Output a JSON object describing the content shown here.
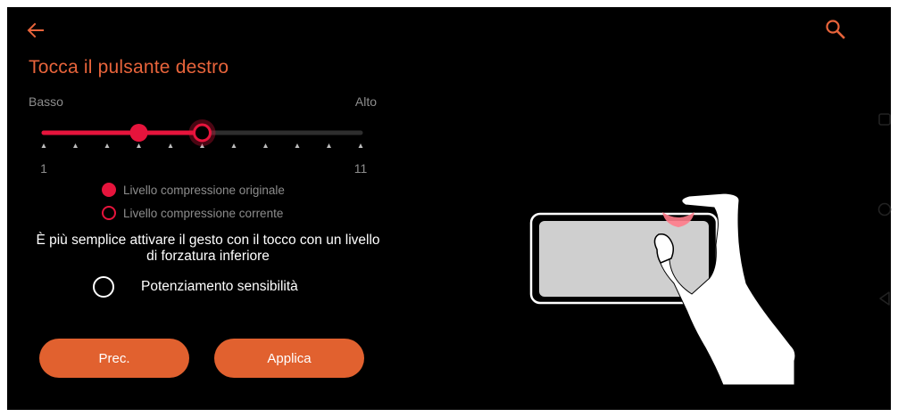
{
  "header": {
    "back_icon": "arrow-left-icon",
    "search_icon": "search-icon"
  },
  "title": "Tocca il pulsante destro",
  "slider": {
    "low_label": "Basso",
    "high_label": "Alto",
    "min": 1,
    "max": 11,
    "min_label": "1",
    "max_label": "11",
    "original_value": 4,
    "current_value": 6
  },
  "legend": {
    "original": "Livello compressione originale",
    "current": "Livello compressione corrente"
  },
  "hint": "È più semplice attivare il gesto con il tocco con un livello di forzatura inferiore",
  "sensitivity": {
    "label": "Potenziamento sensibilità",
    "checked": false
  },
  "buttons": {
    "prev": "Prec.",
    "apply": "Applica"
  },
  "colors": {
    "accent": "#e8643b",
    "button": "#e1612f",
    "slider": "#e6143c",
    "background": "#000000"
  },
  "navigation": {
    "recents_icon": "square-icon",
    "home_icon": "circle-icon",
    "back_icon": "triangle-back-icon"
  }
}
